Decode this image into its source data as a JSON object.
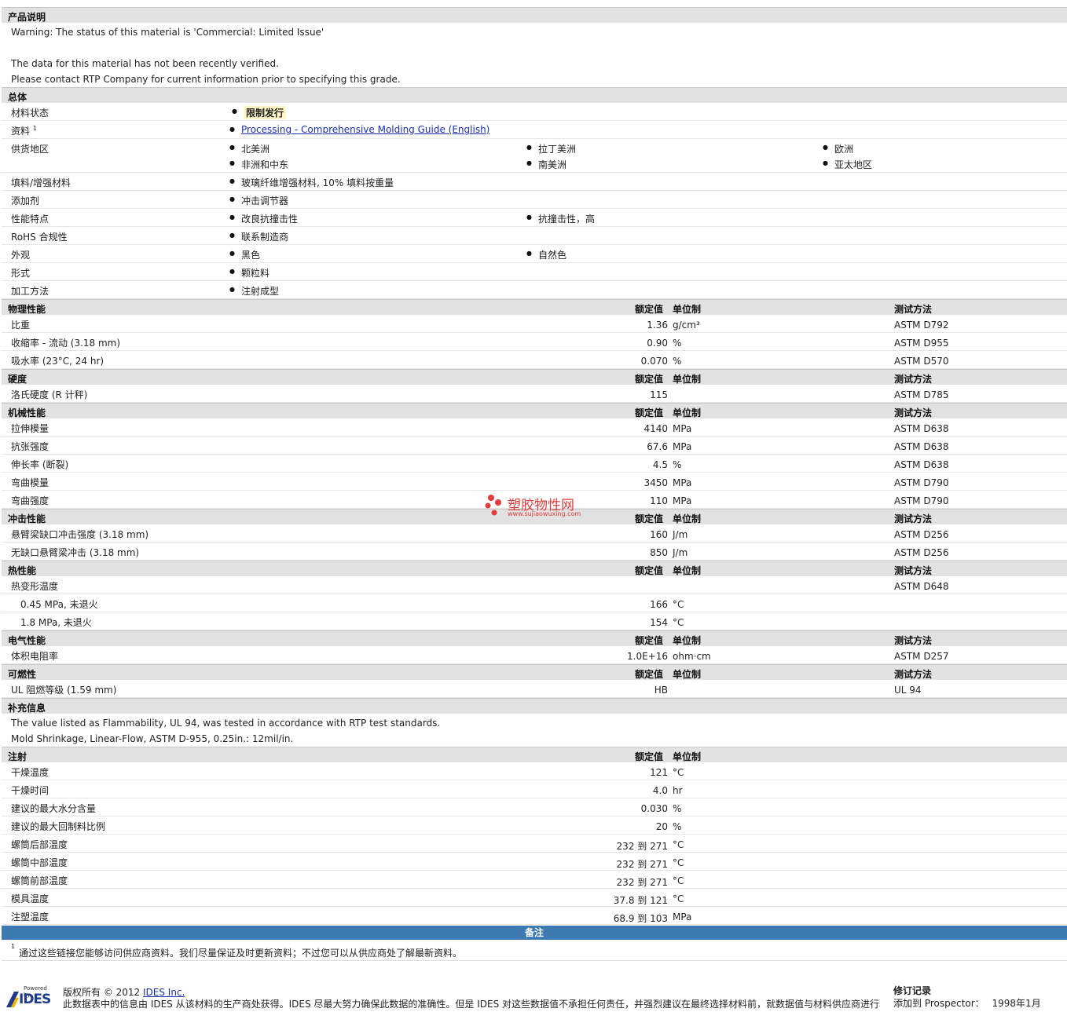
{
  "desc": {
    "title": "产品说明",
    "lines": [
      "Warning: The status of this material is 'Commercial: Limited Issue'",
      "",
      "The data for this material has not been recently verified.",
      "Please contact RTP Company for current information prior to specifying this grade."
    ]
  },
  "general": {
    "title": "总体",
    "status_label": "材料状态",
    "status_value": "限制发行",
    "docs_label": "资料",
    "docs_sup": "1",
    "docs_link": "Processing - Comprehensive Molding Guide (English)",
    "region_label": "供货地区",
    "regions": [
      "北美洲",
      "拉丁美洲",
      "欧洲",
      "非洲和中东",
      "南美洲",
      "亚太地区"
    ],
    "filler_label": "填料/增强材料",
    "filler_value": "玻璃纤维增强材料, 10% 填料按重量",
    "additive_label": "添加剂",
    "additive_value": "冲击调节器",
    "features_label": "性能特点",
    "features": [
      "改良抗撞击性",
      "抗撞击性，高"
    ],
    "rohs_label": "RoHS 合规性",
    "rohs_value": "联系制造商",
    "appearance_label": "外观",
    "appearance": [
      "黑色",
      "自然色"
    ],
    "form_label": "形式",
    "form_value": "颗粒料",
    "process_label": "加工方法",
    "process_value": "注射成型"
  },
  "headers": {
    "nominal": "额定值",
    "unit": "单位制",
    "method": "测试方法"
  },
  "physical": {
    "title": "物理性能",
    "rows": [
      {
        "label": "比重",
        "value": "1.36",
        "unit": "g/cm³",
        "method": "ASTM D792"
      },
      {
        "label": "收缩率  - 流动  (3.18 mm)",
        "value": "0.90",
        "unit": "%",
        "method": "ASTM D955"
      },
      {
        "label": "吸水率  (23°C, 24 hr)",
        "value": "0.070",
        "unit": "%",
        "method": "ASTM D570"
      }
    ]
  },
  "hardness": {
    "title": "硬度",
    "rows": [
      {
        "label": "洛氏硬度  (R 计秤)",
        "value": "115",
        "unit": "",
        "method": "ASTM D785"
      }
    ]
  },
  "mechanical": {
    "title": "机械性能",
    "rows": [
      {
        "label": "拉伸模量",
        "value": "4140",
        "unit": "MPa",
        "method": "ASTM D638"
      },
      {
        "label": "抗张强度",
        "value": "67.6",
        "unit": "MPa",
        "method": "ASTM D638"
      },
      {
        "label": "伸长率  (断裂)",
        "value": "4.5",
        "unit": "%",
        "method": "ASTM D638"
      },
      {
        "label": "弯曲模量",
        "value": "3450",
        "unit": "MPa",
        "method": "ASTM D790"
      },
      {
        "label": "弯曲强度",
        "value": "110",
        "unit": "MPa",
        "method": "ASTM D790"
      }
    ]
  },
  "impact": {
    "title": "冲击性能",
    "rows": [
      {
        "label": "悬臂梁缺口冲击强度  (3.18 mm)",
        "value": "160",
        "unit": "J/m",
        "method": "ASTM D256"
      },
      {
        "label": "无缺口悬臂梁冲击  (3.18 mm)",
        "value": "850",
        "unit": "J/m",
        "method": "ASTM D256"
      }
    ]
  },
  "thermal": {
    "title": "热性能",
    "rows": [
      {
        "label": "热变形温度",
        "value": "",
        "unit": "",
        "method": "ASTM D648",
        "sub": false
      },
      {
        "label": "0.45 MPa, 未退火",
        "value": "166",
        "unit": "°C",
        "method": "",
        "sub": true
      },
      {
        "label": "1.8 MPa, 未退火",
        "value": "154",
        "unit": "°C",
        "method": "",
        "sub": true
      }
    ]
  },
  "electrical": {
    "title": "电气性能",
    "rows": [
      {
        "label": "体积电阻率",
        "value": "1.0E+16",
        "unit": "ohm·cm",
        "method": "ASTM D257"
      }
    ]
  },
  "flammability": {
    "title": "可燃性",
    "rows": [
      {
        "label": "UL 阻燃等级  (1.59 mm)",
        "value": "HB",
        "unit": "",
        "method": "UL 94"
      }
    ]
  },
  "supplement": {
    "title": "补充信息",
    "lines": [
      "The value listed as Flammability, UL 94, was tested in accordance with RTP test standards.",
      "Mold Shrinkage, Linear-Flow, ASTM D-955, 0.25in.: 12mil/in."
    ]
  },
  "injection": {
    "title": "注射",
    "rows": [
      {
        "label": "干燥温度",
        "value": "121",
        "unit": "°C"
      },
      {
        "label": "干燥时间",
        "value": "4.0",
        "unit": "hr"
      },
      {
        "label": "建议的最大水分含量",
        "value": "0.030",
        "unit": "%"
      },
      {
        "label": "建议的最大回制料比例",
        "value": "20",
        "unit": "%"
      },
      {
        "label": "螺筒后部温度",
        "value": "232 到  271",
        "unit": "°C"
      },
      {
        "label": "螺筒中部温度",
        "value": "232 到  271",
        "unit": "°C"
      },
      {
        "label": "螺筒前部温度",
        "value": "232 到  271",
        "unit": "°C"
      },
      {
        "label": "模具温度",
        "value": "37.8 到  121",
        "unit": "°C"
      },
      {
        "label": "注塑温度",
        "value": "68.9 到  103",
        "unit": "MPa"
      }
    ]
  },
  "notes": {
    "title": "备注",
    "sup": "1",
    "text": "通过这些链接您能够访问供应商资料。我们尽量保证及时更新资料；不过您可以从供应商处了解最新资料。"
  },
  "watermark": {
    "title": "塑胶物性网",
    "url": "www.sujiaowuxing.com"
  },
  "footer": {
    "logo_small": "Powered by",
    "logo": "IDES",
    "copyright": "版权所有  © 2012",
    "company_link": "IDES Inc.",
    "disclaimer": "此数据表中的信息由  IDES 从该材料的生产商处获得。IDES 尽最大努力确保此数据的准确性。但是  IDES 对这些数据值不承担任何责任，并强烈建议在最终选择材料前，就数据值与材料供应商进行验",
    "rev_title": "修订记录",
    "rev_label": "添加到  Prospector：",
    "rev_value": "1998年1月"
  }
}
